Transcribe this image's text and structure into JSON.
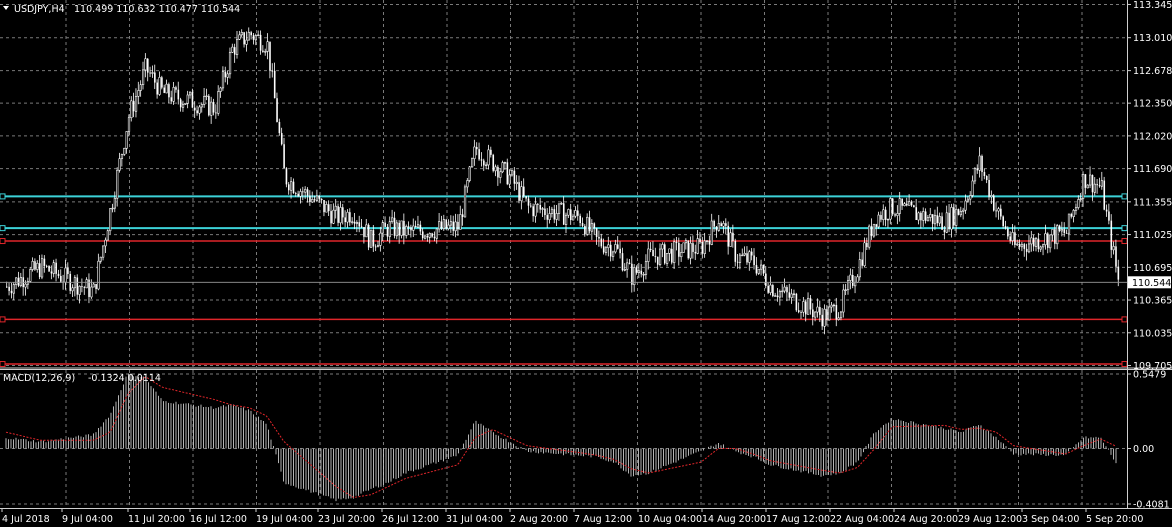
{
  "header": {
    "symbol": "USDJPY,H4",
    "ohlc": "110.499 110.632 110.477 110.544"
  },
  "indicator": {
    "name": "MACD(12,26,9)",
    "values": "-0.1324 0.0114"
  },
  "price_axis": {
    "ticks": [
      "113.345",
      "113.010",
      "112.678",
      "112.350",
      "112.020",
      "111.690",
      "111.355",
      "111.025",
      "110.695",
      "110.365",
      "110.035",
      "109.705"
    ],
    "current_label": "110.544"
  },
  "macd_axis": {
    "ticks": [
      "0.5479",
      "0.00",
      "-0.4081"
    ]
  },
  "time_axis": {
    "labels": [
      "4 Jul 2018",
      "9 Jul 04:00",
      "11 Jul 20:00",
      "16 Jul 12:00",
      "19 Jul 04:00",
      "23 Jul 20:00",
      "26 Jul 12:00",
      "31 Jul 04:00",
      "2 Aug 20:00",
      "7 Aug 12:00",
      "10 Aug 04:00",
      "14 Aug 20:00",
      "17 Aug 12:00",
      "22 Aug 04:00",
      "24 Aug 20:00",
      "29 Aug 12:00",
      "3 Sep 04:00",
      "5 Sep 20:00"
    ]
  },
  "colors": {
    "background": "#000000",
    "grid": "#7a7a7a",
    "candle": "#ffffff",
    "cyan_line": "#3cd2d8",
    "red_line": "#e0262a",
    "macd_hist": "#c8c8c8",
    "macd_signal": "#e0262a"
  },
  "chart_data": {
    "type": "candlestick",
    "title": "USDJPY,H4",
    "ylim": [
      109.69,
      113.39
    ],
    "x_range": [
      "4 Jul 2018",
      "6 Sep 2018"
    ],
    "horizontal_lines": [
      {
        "color": "cyan",
        "price": 111.41
      },
      {
        "color": "cyan",
        "price": 111.09
      },
      {
        "color": "red",
        "price": 110.96
      },
      {
        "color": "red",
        "price": 110.17
      },
      {
        "color": "red",
        "price": 109.72
      }
    ],
    "price_path": [
      [
        "4 Jul 2018",
        110.5
      ],
      [
        "6 Jul",
        110.7
      ],
      [
        "9 Jul",
        110.45
      ],
      [
        "10 Jul",
        111.3
      ],
      [
        "11 Jul",
        112.2
      ],
      [
        "12 Jul",
        112.7
      ],
      [
        "13 Jul",
        112.45
      ],
      [
        "16 Jul",
        112.3
      ],
      [
        "17 Jul",
        112.9
      ],
      [
        "18 Jul",
        113.05
      ],
      [
        "19 Jul",
        112.95
      ],
      [
        "20 Jul",
        111.6
      ],
      [
        "23 Jul",
        111.2
      ],
      [
        "24 Jul",
        111.25
      ],
      [
        "25 Jul",
        110.95
      ],
      [
        "26 Jul",
        111.1
      ],
      [
        "27 Jul",
        111.05
      ],
      [
        "30 Jul",
        111.1
      ],
      [
        "31 Jul",
        111.9
      ],
      [
        "1 Aug",
        111.75
      ],
      [
        "2 Aug",
        111.6
      ],
      [
        "3 Aug",
        111.3
      ],
      [
        "6 Aug",
        111.2
      ],
      [
        "7 Aug",
        110.95
      ],
      [
        "8 Aug",
        110.9
      ],
      [
        "9 Aug",
        110.6
      ],
      [
        "10 Aug",
        110.8
      ],
      [
        "13 Aug",
        110.9
      ],
      [
        "14 Aug",
        111.2
      ],
      [
        "15 Aug",
        110.8
      ],
      [
        "16 Aug",
        110.75
      ],
      [
        "17 Aug",
        110.5
      ],
      [
        "20 Aug",
        110.2
      ],
      [
        "21 Aug",
        110.3
      ],
      [
        "22 Aug",
        110.7
      ],
      [
        "23 Aug",
        111.2
      ],
      [
        "24 Aug",
        111.3
      ],
      [
        "27 Aug",
        111.15
      ],
      [
        "28 Aug",
        111.3
      ],
      [
        "29 Aug",
        111.75
      ],
      [
        "30 Aug",
        111.25
      ],
      [
        "31 Aug",
        110.9
      ],
      [
        "3 Sep",
        111.05
      ],
      [
        "4 Sep",
        111.6
      ],
      [
        "5 Sep",
        111.5
      ],
      [
        "6 Sep",
        110.54
      ]
    ],
    "macd_range": [
      -0.4081,
      0.5479
    ],
    "macd_histogram_path": [
      [
        "4 Jul 2018",
        0.08
      ],
      [
        "6 Jul",
        0.05
      ],
      [
        "9 Jul",
        0.1
      ],
      [
        "10 Jul",
        0.25
      ],
      [
        "11 Jul",
        0.55
      ],
      [
        "12 Jul",
        0.52
      ],
      [
        "13 Jul",
        0.35
      ],
      [
        "16 Jul",
        0.3
      ],
      [
        "17 Jul",
        0.32
      ],
      [
        "18 Jul",
        0.28
      ],
      [
        "19 Jul",
        0.18
      ],
      [
        "20 Jul",
        -0.25
      ],
      [
        "23 Jul",
        -0.38
      ],
      [
        "24 Jul",
        -0.36
      ],
      [
        "25 Jul",
        -0.3
      ],
      [
        "26 Jul",
        -0.25
      ],
      [
        "27 Jul",
        -0.18
      ],
      [
        "30 Jul",
        -0.05
      ],
      [
        "31 Jul",
        0.2
      ],
      [
        "1 Aug",
        0.12
      ],
      [
        "2 Aug",
        0.05
      ],
      [
        "3 Aug",
        -0.02
      ],
      [
        "6 Aug",
        -0.05
      ],
      [
        "7 Aug",
        -0.06
      ],
      [
        "8 Aug",
        -0.1
      ],
      [
        "9 Aug",
        -0.2
      ],
      [
        "10 Aug",
        -0.18
      ],
      [
        "13 Aug",
        -0.02
      ],
      [
        "14 Aug",
        0.04
      ],
      [
        "15 Aug",
        -0.02
      ],
      [
        "16 Aug",
        -0.06
      ],
      [
        "17 Aug",
        -0.12
      ],
      [
        "20 Aug",
        -0.2
      ],
      [
        "21 Aug",
        -0.18
      ],
      [
        "22 Aug",
        -0.1
      ],
      [
        "23 Aug",
        0.12
      ],
      [
        "24 Aug",
        0.22
      ],
      [
        "27 Aug",
        0.15
      ],
      [
        "28 Aug",
        0.12
      ],
      [
        "29 Aug",
        0.18
      ],
      [
        "30 Aug",
        0.08
      ],
      [
        "31 Aug",
        -0.04
      ],
      [
        "3 Sep",
        -0.05
      ],
      [
        "4 Sep",
        0.08
      ],
      [
        "5 Sep",
        0.08
      ],
      [
        "6 Sep",
        -0.13
      ]
    ],
    "macd_signal_path": [
      [
        "4 Jul 2018",
        0.12
      ],
      [
        "6 Jul",
        0.06
      ],
      [
        "9 Jul",
        0.06
      ],
      [
        "10 Jul",
        0.12
      ],
      [
        "11 Jul",
        0.4
      ],
      [
        "12 Jul",
        0.53
      ],
      [
        "13 Jul",
        0.45
      ],
      [
        "16 Jul",
        0.36
      ],
      [
        "17 Jul",
        0.32
      ],
      [
        "18 Jul",
        0.3
      ],
      [
        "19 Jul",
        0.24
      ],
      [
        "20 Jul",
        0.05
      ],
      [
        "23 Jul",
        -0.28
      ],
      [
        "24 Jul",
        -0.36
      ],
      [
        "25 Jul",
        -0.34
      ],
      [
        "26 Jul",
        -0.28
      ],
      [
        "27 Jul",
        -0.22
      ],
      [
        "30 Jul",
        -0.12
      ],
      [
        "31 Jul",
        0.08
      ],
      [
        "1 Aug",
        0.14
      ],
      [
        "2 Aug",
        0.08
      ],
      [
        "3 Aug",
        0.02
      ],
      [
        "6 Aug",
        -0.03
      ],
      [
        "7 Aug",
        -0.05
      ],
      [
        "8 Aug",
        -0.08
      ],
      [
        "9 Aug",
        -0.15
      ],
      [
        "10 Aug",
        -0.18
      ],
      [
        "13 Aug",
        -0.1
      ],
      [
        "14 Aug",
        0.0
      ],
      [
        "15 Aug",
        0.0
      ],
      [
        "16 Aug",
        -0.04
      ],
      [
        "17 Aug",
        -0.09
      ],
      [
        "20 Aug",
        -0.16
      ],
      [
        "21 Aug",
        -0.18
      ],
      [
        "22 Aug",
        -0.14
      ],
      [
        "23 Aug",
        0.0
      ],
      [
        "24 Aug",
        0.16
      ],
      [
        "27 Aug",
        0.17
      ],
      [
        "28 Aug",
        0.14
      ],
      [
        "29 Aug",
        0.15
      ],
      [
        "30 Aug",
        0.12
      ],
      [
        "31 Aug",
        0.02
      ],
      [
        "3 Sep",
        -0.04
      ],
      [
        "4 Sep",
        0.02
      ],
      [
        "5 Sep",
        0.07
      ],
      [
        "6 Sep",
        0.01
      ]
    ]
  }
}
